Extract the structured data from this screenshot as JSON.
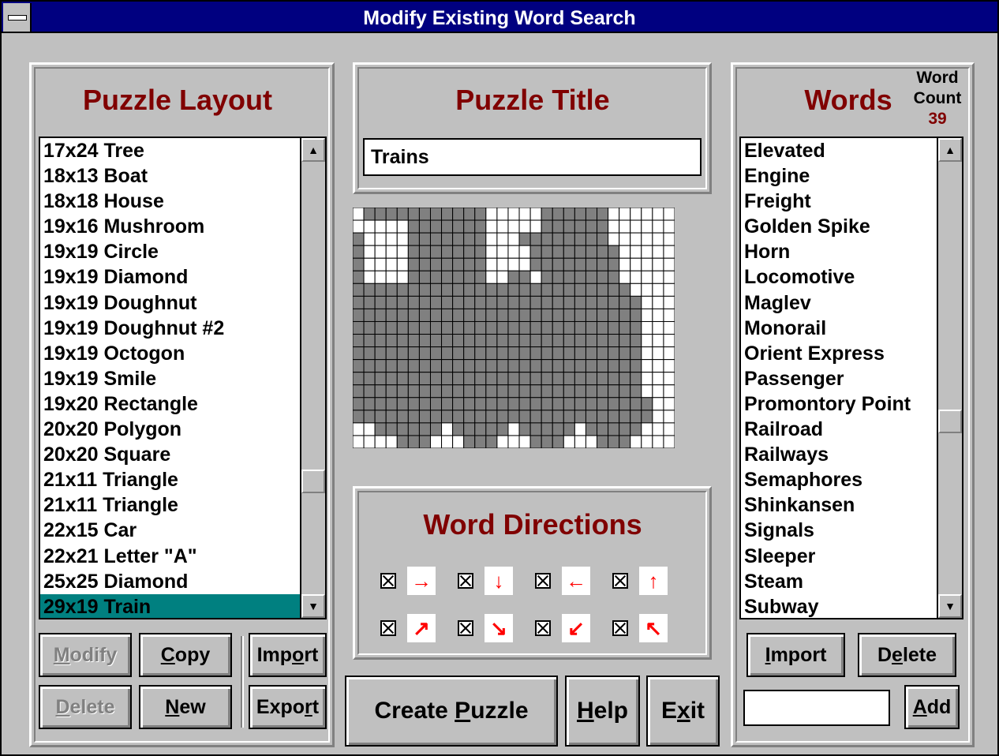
{
  "window": {
    "title": "Modify Existing Word Search"
  },
  "layout_panel": {
    "heading": "Puzzle Layout",
    "items": [
      "17x24 Tree",
      "18x13 Boat",
      "18x18 House",
      "19x16 Mushroom",
      "19x19 Circle",
      "19x19 Diamond",
      "19x19 Doughnut",
      "19x19 Doughnut #2",
      "19x19 Octogon",
      "19x19 Smile",
      "19x20 Rectangle",
      "20x20 Polygon",
      "20x20 Square",
      "21x11 Triangle",
      "21x11 Triangle",
      "22x15 Car",
      "22x21 Letter \"A\"",
      "25x25 Diamond",
      "29x19 Train"
    ],
    "selected": "29x19 Train",
    "buttons": {
      "modify": "Modify",
      "copy": "Copy",
      "import": "Import",
      "delete": "Delete",
      "new": "New",
      "export": "Export"
    }
  },
  "title_panel": {
    "heading": "Puzzle Title",
    "title_value": "Trains"
  },
  "directions_panel": {
    "heading": "Word Directions",
    "row1": [
      "→",
      "↓",
      "←",
      "↑"
    ],
    "row2": [
      "↗",
      "↘",
      "↙",
      "↖"
    ],
    "checked": true
  },
  "words_panel": {
    "heading": "Words",
    "count_label_1": "Word",
    "count_label_2": "Count",
    "count": "39",
    "items": [
      "Elevated",
      "Engine",
      "Freight",
      "Golden Spike",
      "Horn",
      "Locomotive",
      "Maglev",
      "Monorail",
      "Orient Express",
      "Passenger",
      "Promontory Point",
      "Railroad",
      "Railways",
      "Semaphores",
      "Shinkansen",
      "Signals",
      "Sleeper",
      "Steam",
      "Subway"
    ],
    "buttons": {
      "import": "Import",
      "delete": "Delete",
      "add": "Add"
    },
    "add_input_value": ""
  },
  "bottom_buttons": {
    "create": "Create Puzzle",
    "help": "Help",
    "exit": "Exit"
  },
  "colors": {
    "title_bg": "#000080",
    "heading": "#800000",
    "selection": "#008080",
    "arrow": "#ff0000",
    "grid_fill": "#808080"
  }
}
